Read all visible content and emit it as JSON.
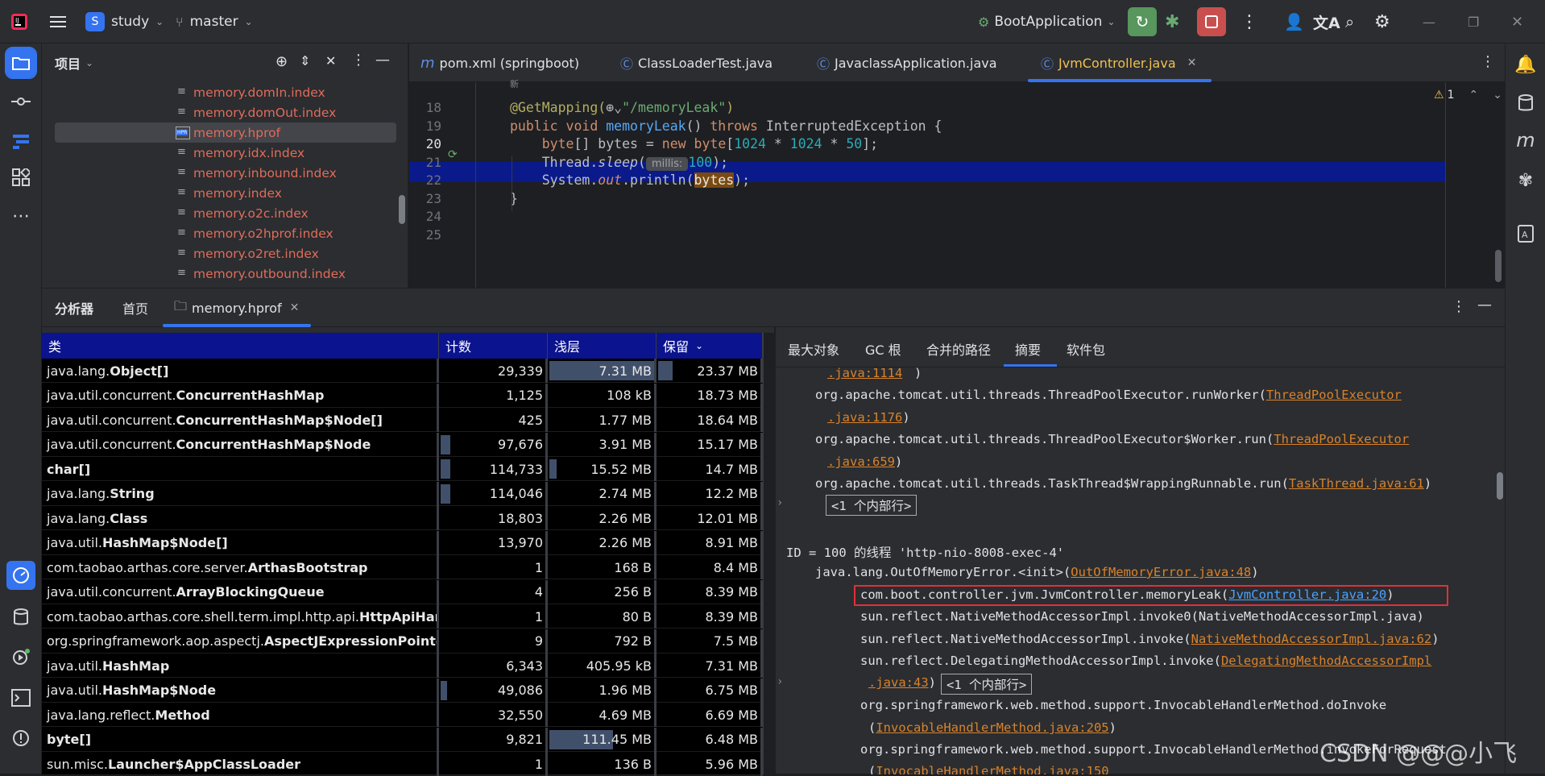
{
  "titlebar": {
    "project_letter": "S",
    "project": "study",
    "branch": "master",
    "run_config": "BootApplication"
  },
  "project_panel": {
    "title": "项目",
    "files": [
      "memory.domIn.index",
      "memory.domOut.index",
      "memory.hprof",
      "memory.idx.index",
      "memory.inbound.index",
      "memory.index",
      "memory.o2c.index",
      "memory.o2hprof.index",
      "memory.o2ret.index",
      "memory.outbound.index"
    ],
    "selected_index": 2,
    "hprof_badge": "HPR"
  },
  "editor": {
    "tabs": [
      {
        "label": "pom.xml (springboot)",
        "icon": "m-icon"
      },
      {
        "label": "ClassLoaderTest.java",
        "icon": "c-icon"
      },
      {
        "label": "JavaclassApplication.java",
        "icon": "c-icon"
      },
      {
        "label": "JvmController.java",
        "icon": "c-icon",
        "active": true
      }
    ],
    "warnings": "1",
    "hint_top": "新",
    "lines": [
      {
        "n": "18",
        "parts": [
          {
            "t": "@GetMapping(",
            "c": "ann"
          },
          {
            "t": "⊕⌄",
            "c": ""
          },
          {
            "t": "\"/memoryLeak\"",
            "c": "str"
          },
          {
            "t": ")",
            "c": "ann"
          }
        ]
      },
      {
        "n": "19",
        "parts": [
          {
            "t": "public void ",
            "c": "kw"
          },
          {
            "t": "memoryLeak",
            "c": "fn"
          },
          {
            "t": "() ",
            "c": ""
          },
          {
            "t": "throws ",
            "c": "kw"
          },
          {
            "t": "InterruptedException {",
            "c": ""
          }
        ]
      },
      {
        "n": "20",
        "parts": [
          {
            "t": "    byte",
            "c": "kw"
          },
          {
            "t": "[] bytes = ",
            "c": ""
          },
          {
            "t": "new ",
            "c": "kw"
          },
          {
            "t": "byte",
            "c": "kw"
          },
          {
            "t": "[",
            "c": ""
          },
          {
            "t": "1024",
            "c": "num"
          },
          {
            "t": " * ",
            "c": ""
          },
          {
            "t": "1024",
            "c": "num"
          },
          {
            "t": " * ",
            "c": ""
          },
          {
            "t": "50",
            "c": "num"
          },
          {
            "t": "];",
            "c": ""
          }
        ]
      },
      {
        "n": "21",
        "parts": [
          {
            "t": "    Thread.",
            "c": ""
          },
          {
            "t": "sleep",
            "c": "it"
          },
          {
            "t": "(",
            "c": ""
          },
          {
            "t": " millis: ",
            "c": "hint"
          },
          {
            "t": "100",
            "c": "num"
          },
          {
            "t": ");",
            "c": ""
          }
        ]
      },
      {
        "n": "22",
        "parts": [
          {
            "t": "    System.",
            "c": ""
          },
          {
            "t": "out",
            "c": "it kw"
          },
          {
            "t": ".println(",
            "c": ""
          },
          {
            "t": "bytes",
            "c": "hl"
          },
          {
            "t": ");",
            "c": ""
          }
        ]
      },
      {
        "n": "23",
        "parts": [
          {
            "t": "}",
            "c": ""
          }
        ]
      },
      {
        "n": "24",
        "parts": []
      },
      {
        "n": "25",
        "parts": []
      }
    ]
  },
  "analyzer": {
    "tabs": [
      "分析器",
      "首页",
      "memory.hprof"
    ],
    "columns": [
      "类",
      "计数",
      "浅层",
      "保留"
    ],
    "rows": [
      {
        "pre": "java.lang.",
        "cls": "Object[]",
        "count": "29,339",
        "shallow": "7.31 MB",
        "retained": "23.37 MB",
        "cb": 0,
        "sb": 1,
        "rb": 0.14
      },
      {
        "pre": "java.util.concurrent.",
        "cls": "ConcurrentHashMap",
        "count": "1,125",
        "shallow": "108 kB",
        "retained": "18.73 MB",
        "cb": 0,
        "sb": 0,
        "rb": 0
      },
      {
        "pre": "java.util.concurrent.",
        "cls": "ConcurrentHashMap$Node[]",
        "count": "425",
        "shallow": "1.77 MB",
        "retained": "18.64 MB",
        "cb": 0,
        "sb": 0,
        "rb": 0
      },
      {
        "pre": "java.util.concurrent.",
        "cls": "ConcurrentHashMap$Node",
        "count": "97,676",
        "shallow": "3.91 MB",
        "retained": "15.17 MB",
        "cb": 0.09,
        "sb": 0,
        "rb": 0
      },
      {
        "pre": "",
        "cls": "char[]",
        "count": "114,733",
        "shallow": "15.52 MB",
        "retained": "14.7 MB",
        "cb": 0.09,
        "sb": 0.07,
        "rb": 0
      },
      {
        "pre": "java.lang.",
        "cls": "String",
        "count": "114,046",
        "shallow": "2.74 MB",
        "retained": "12.2 MB",
        "cb": 0.09,
        "sb": 0,
        "rb": 0
      },
      {
        "pre": "java.lang.",
        "cls": "Class",
        "count": "18,803",
        "shallow": "2.26 MB",
        "retained": "12.01 MB",
        "cb": 0,
        "sb": 0,
        "rb": 0
      },
      {
        "pre": "java.util.",
        "cls": "HashMap$Node[]",
        "count": "13,970",
        "shallow": "2.26 MB",
        "retained": "8.91 MB",
        "cb": 0,
        "sb": 0,
        "rb": 0
      },
      {
        "pre": "com.taobao.arthas.core.server.",
        "cls": "ArthasBootstrap",
        "count": "1",
        "shallow": "168 B",
        "retained": "8.4 MB",
        "cb": 0,
        "sb": 0,
        "rb": 0
      },
      {
        "pre": "java.util.concurrent.",
        "cls": "ArrayBlockingQueue",
        "count": "4",
        "shallow": "256 B",
        "retained": "8.39 MB",
        "cb": 0,
        "sb": 0,
        "rb": 0
      },
      {
        "pre": "com.taobao.arthas.core.shell.term.impl.http.api.",
        "cls": "HttpApiHandle",
        "count": "1",
        "shallow": "80 B",
        "retained": "8.39 MB",
        "cb": 0,
        "sb": 0,
        "rb": 0
      },
      {
        "pre": "org.springframework.aop.aspectj.",
        "cls": "AspectJExpressionPointcu",
        "count": "9",
        "shallow": "792 B",
        "retained": "7.5 MB",
        "cb": 0,
        "sb": 0,
        "rb": 0
      },
      {
        "pre": "java.util.",
        "cls": "HashMap",
        "count": "6,343",
        "shallow": "405.95 kB",
        "retained": "7.31 MB",
        "cb": 0,
        "sb": 0,
        "rb": 0
      },
      {
        "pre": "java.util.",
        "cls": "HashMap$Node",
        "count": "49,086",
        "shallow": "1.96 MB",
        "retained": "6.75 MB",
        "cb": 0.03,
        "sb": 0,
        "rb": 0
      },
      {
        "pre": "java.lang.reflect.",
        "cls": "Method",
        "count": "32,550",
        "shallow": "4.69 MB",
        "retained": "6.69 MB",
        "cb": 0,
        "sb": 0,
        "rb": 0
      },
      {
        "pre": "",
        "cls": "byte[]",
        "count": "9,821",
        "shallow": "111.45 MB",
        "retained": "6.48 MB",
        "cb": 0,
        "sb": 0.6,
        "rb": 0
      },
      {
        "pre": "sun.misc.",
        "cls": "Launcher$AppClassLoader",
        "count": "1",
        "shallow": "136 B",
        "retained": "5.96 MB",
        "cb": 0,
        "sb": 0,
        "rb": 0
      }
    ],
    "right_tabs": [
      "最大对象",
      "GC 根",
      "合并的路径",
      "摘要",
      "软件包"
    ],
    "active_right_tab": "摘要",
    "stack": {
      "l0": ".java:1114",
      "l1a": "org.apache.tomcat.util.threads.ThreadPoolExecutor.runWorker(",
      "l1b": "ThreadPoolExecutor",
      "l2": ".java:1176",
      "l3a": "org.apache.tomcat.util.threads.ThreadPoolExecutor$Worker.run(",
      "l3b": "ThreadPoolExecutor",
      "l4": ".java:659",
      "l5a": "org.apache.tomcat.util.threads.TaskThread$WrappingRunnable.run(",
      "l5b": "TaskThread.java:61",
      "inner1": "<1 个内部行>",
      "thread": "ID = 100 的线程 'http-nio-8008-exec-4'",
      "l7a": "java.lang.OutOfMemoryError.<init>(",
      "l7b": "OutOfMemoryError.java:48",
      "l8a": "com.boot.controller.jvm.JvmController.memoryLeak(",
      "l8b": "JvmController.java:20",
      "l9": "sun.reflect.NativeMethodAccessorImpl.invoke0(NativeMethodAccessorImpl.java)",
      "l10a": "sun.reflect.NativeMethodAccessorImpl.invoke(",
      "l10b": "NativeMethodAccessorImpl.java:62",
      "l11a": "sun.reflect.DelegatingMethodAccessorImpl.invoke(",
      "l11b": "DelegatingMethodAccessorImpl",
      "l12": ".java:43",
      "inner2": "<1 个内部行>",
      "l13": "org.springframework.web.method.support.InvocableHandlerMethod.doInvoke",
      "l14": "InvocableHandlerMethod.java:205",
      "l15": "org.springframework.web.method.support.InvocableHandlerMethod.invokeForRequest",
      "l16": "InvocableHandlerMethod.java:150"
    }
  },
  "watermark": "CSDN @@@小飞",
  "colors": {
    "accent": "#3574f0",
    "table_header": "#0b138e",
    "selection": "#0a1a8a",
    "error_box": "#e0303a"
  }
}
